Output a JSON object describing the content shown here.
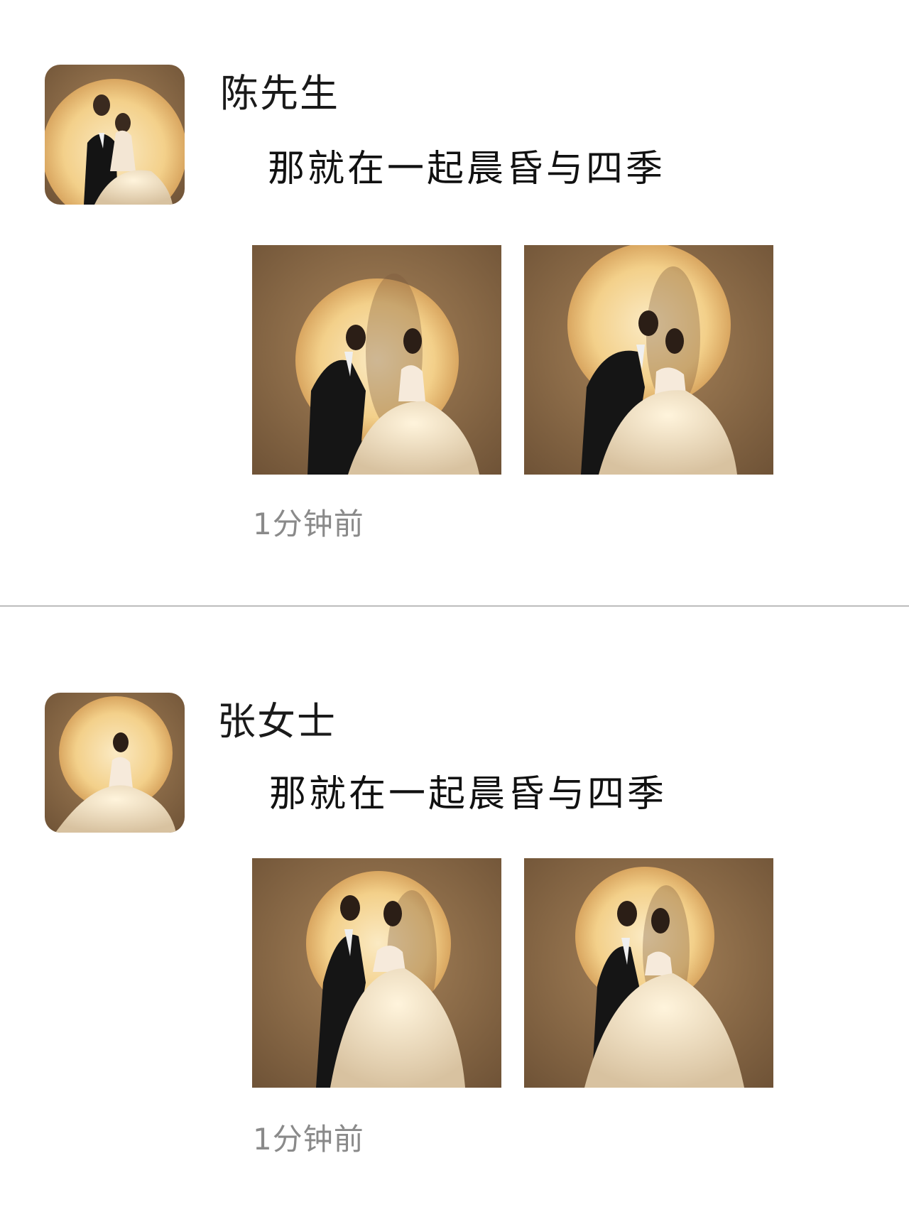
{
  "posts": [
    {
      "username": "陈先生",
      "text": "那就在一起晨昏与四季",
      "timestamp": "1分钟前"
    },
    {
      "username": "张女士",
      "text": "那就在一起晨昏与四季",
      "timestamp": "1分钟前"
    }
  ],
  "colors": {
    "photo_background": "#8b6a4a",
    "spotlight": "#f7dca0",
    "timestamp_gray": "#8a8a8a",
    "divider": "#bdbdbd"
  }
}
